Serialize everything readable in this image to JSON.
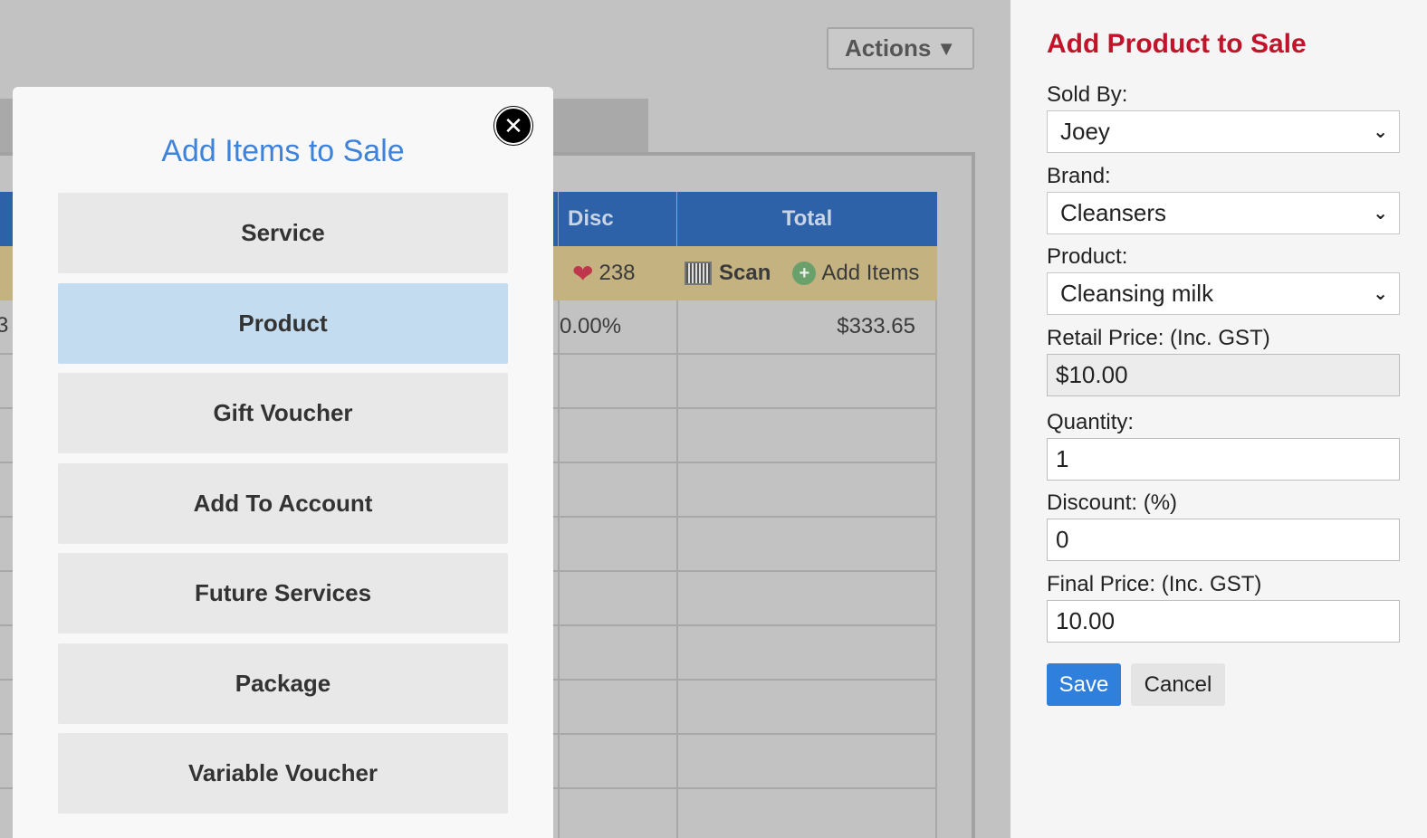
{
  "background": {
    "actions_label": "Actions",
    "actions_icon": "caret-down-icon",
    "grid": {
      "headers": {
        "disc": "Disc",
        "total": "Total"
      },
      "toolbar": {
        "loyalty_points": "238",
        "scan_label": "Scan",
        "add_items_label": "Add Items"
      },
      "rows": [
        {
          "left": "3",
          "disc": "0.00%",
          "total": "$333.65"
        }
      ]
    }
  },
  "modal": {
    "title": "Add Items to Sale",
    "close_icon": "close-icon",
    "items": [
      {
        "label": "Service",
        "active": false
      },
      {
        "label": "Product",
        "active": true
      },
      {
        "label": "Gift Voucher",
        "active": false
      },
      {
        "label": "Add To Account",
        "active": false
      },
      {
        "label": "Future Services",
        "active": false
      },
      {
        "label": "Package",
        "active": false
      },
      {
        "label": "Variable Voucher",
        "active": false
      }
    ]
  },
  "panel": {
    "title": "Add Product to Sale",
    "sold_by": {
      "label": "Sold By:",
      "value": "Joey"
    },
    "brand": {
      "label": "Brand:",
      "value": "Cleansers"
    },
    "product": {
      "label": "Product:",
      "value": "Cleansing milk"
    },
    "retail_price": {
      "label": "Retail Price: (Inc. GST)",
      "value": "$10.00"
    },
    "quantity": {
      "label": "Quantity:",
      "value": "1"
    },
    "discount": {
      "label": "Discount: (%)",
      "value": "0"
    },
    "final_price": {
      "label": "Final Price: (Inc. GST)",
      "value": "10.00"
    },
    "save_label": "Save",
    "cancel_label": "Cancel"
  },
  "colors": {
    "modal_title": "#3d82db",
    "panel_title": "#c0142b",
    "save_button": "#2f7fdc",
    "active_item": "#c4dcef",
    "grid_header": "#2d62a8"
  }
}
